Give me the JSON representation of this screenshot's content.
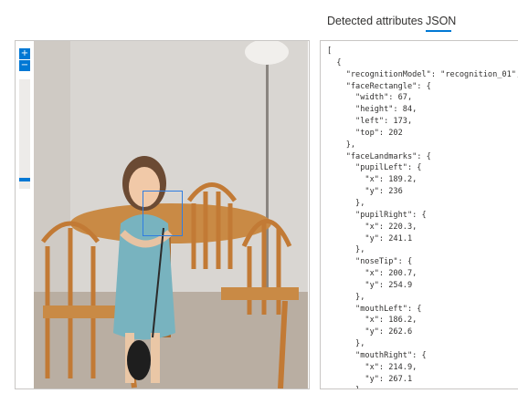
{
  "tabs": [
    {
      "label": "Detected attributes"
    },
    {
      "label": "JSON"
    }
  ],
  "viewer": {
    "zoom_in_label": "+",
    "zoom_out_label": "−"
  },
  "json_lines": [
    "[",
    "  {",
    "    \"recognitionModel\": \"recognition_01\",",
    "    \"faceRectangle\": {",
    "      \"width\": 67,",
    "      \"height\": 84,",
    "      \"left\": 173,",
    "      \"top\": 202",
    "    },",
    "    \"faceLandmarks\": {",
    "      \"pupilLeft\": {",
    "        \"x\": 189.2,",
    "        \"y\": 236",
    "      },",
    "      \"pupilRight\": {",
    "        \"x\": 220.3,",
    "        \"y\": 241.1",
    "      },",
    "      \"noseTip\": {",
    "        \"x\": 200.7,",
    "        \"y\": 254.9",
    "      },",
    "      \"mouthLeft\": {",
    "        \"x\": 186.2,",
    "        \"y\": 262.6",
    "      },",
    "      \"mouthRight\": {",
    "        \"x\": 214.9,",
    "        \"y\": 267.1",
    "      },"
  ],
  "colors": {
    "accent": "#0078d4",
    "face_box": "#2f7de1"
  }
}
